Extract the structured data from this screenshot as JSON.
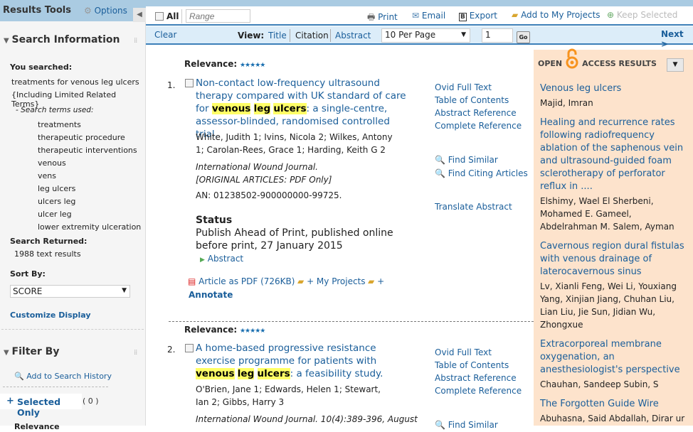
{
  "sidebar": {
    "title": "Results Tools",
    "options": "Options",
    "search_info": "Search Information",
    "you_searched": "You searched:",
    "query": "treatments for venous leg ulcers",
    "limited": "{Including Limited Related Terms}",
    "terms_used": "- Search terms used:",
    "terms": [
      "treatments",
      "therapeutic procedure",
      "therapeutic interventions",
      "venous",
      "vens",
      "leg ulcers",
      "ulcers leg",
      "ulcer leg",
      "lower extremity ulceration"
    ],
    "search_returned": "Search Returned:",
    "results": "1988 text results",
    "sort_by": "Sort By:",
    "sort_value": "SCORE",
    "customize": "Customize Display",
    "filter_by": "Filter By",
    "add_history": "Add to Search History",
    "selected_only": "Selected Only",
    "selected_count": "( 0 )",
    "next_section": "Relevance"
  },
  "toolbar": {
    "all": "All",
    "range_placeholder": "Range",
    "print": "Print",
    "email": "Email",
    "export": "Export",
    "add_projects": "Add to My Projects",
    "keep_selected": "Keep Selected"
  },
  "viewbar": {
    "clear": "Clear",
    "view": "View:",
    "title": "Title",
    "citation": "Citation",
    "abstract": "Abstract",
    "per_page": "10 Per Page",
    "page": "1",
    "go": "Go",
    "next": "Next >"
  },
  "results": [
    {
      "relevance": "Relevance:",
      "num": "1.",
      "title_pre": "Non-contact low-frequency ultrasound therapy compared with UK standard of care for ",
      "hl1": "venous",
      "hl2": "leg",
      "hl3": "ulcers",
      "title_post": ": a single-centre, assessor-blinded, randomised controlled trial.",
      "authors": "White, Judith 1; Ivins, Nicola 2; Wilkes, Antony 1; Carolan-Rees, Grace 1; Harding, Keith G 2",
      "journal": "International Wound Journal.",
      "journal2": "[ORIGINAL ARTICLES: PDF Only]",
      "an": "AN: 01238502-900000000-99725.",
      "status_h": "Status",
      "status": "Publish Ahead of Print, published online before print, 27 January 2015",
      "abstract": "Abstract",
      "pdf": "Article as PDF (726KB)",
      "projects": "+ My Projects",
      "annotate_plus": "+",
      "annotate": "Annotate",
      "links": [
        "Ovid Full Text",
        "Table of Contents",
        "Abstract Reference",
        "Complete Reference"
      ],
      "find_similar": "Find Similar",
      "find_citing": "Find Citing Articles",
      "translate": "Translate Abstract"
    },
    {
      "relevance": "Relevance:",
      "num": "2.",
      "title_pre": "A home-based progressive resistance exercise programme for patients with ",
      "hl1": "venous",
      "hl2": "leg",
      "hl3": "ulcers",
      "title_post": ": a feasibility study.",
      "authors": "O'Brien, Jane 1; Edwards, Helen 1; Stewart, Ian 2; Gibbs, Harry 3",
      "journal": "International Wound Journal. 10(4):389-396, August",
      "links": [
        "Ovid Full Text",
        "Table of Contents",
        "Abstract Reference",
        "Complete Reference"
      ],
      "find_similar": "Find Similar"
    }
  ],
  "open_access": {
    "open": "OPEN",
    "access": "ACCESS RESULTS",
    "items": [
      {
        "title": "Venous leg ulcers",
        "authors": "Majid, Imran"
      },
      {
        "title": "Healing and recurrence rates following radiofrequency ablation of the saphenous vein and ultrasound-guided foam sclerotherapy of perforator reflux in ....",
        "authors": "Elshimy, Wael El Sherbeni, Mohamed E. Gameel, Abdelrahman M. Salem, Ayman"
      },
      {
        "title": "Cavernous region dural fistulas with venous drainage of laterocavernous sinus",
        "authors": "Lv, Xianli Feng, Wei Li, Youxiang Yang, Xinjian Jiang, Chuhan Liu, Lian Liu, Jie Sun, Jidian Wu, Zhongxue"
      },
      {
        "title": "Extracorporeal membrane oxygenation, an anesthesiologist's perspective",
        "authors": "Chauhan, Sandeep Subin, S"
      },
      {
        "title": "The Forgotten Guide Wire",
        "authors": "Abuhasna, Said Abdallah, Dirar ur"
      }
    ]
  },
  "colors": {
    "link": "#1a5e9a",
    "header": "#aacbe2",
    "viewbar": "#dcedf9",
    "open_access_bg": "#fde3cc",
    "highlight": "#ffff66",
    "oa_orange": "#f7931e"
  }
}
